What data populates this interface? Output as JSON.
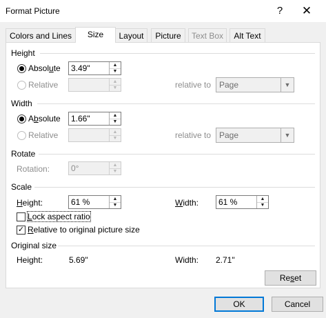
{
  "window": {
    "title": "Format Picture",
    "help_glyph": "?",
    "close_glyph": "✕"
  },
  "tabs": [
    {
      "label": "Colors and Lines",
      "state": "normal"
    },
    {
      "label": "Size",
      "state": "active"
    },
    {
      "label": "Layout",
      "state": "normal"
    },
    {
      "label": "Picture",
      "state": "normal"
    },
    {
      "label": "Text Box",
      "state": "disabled"
    },
    {
      "label": "Alt Text",
      "state": "normal"
    }
  ],
  "height": {
    "section": "Height",
    "absolute": {
      "pre": "Absol",
      "accel": "u",
      "post": "te",
      "value": "3.49\"",
      "selected": true
    },
    "relative": {
      "label": "Relative",
      "value": ""
    },
    "relative_to_label": "relative to",
    "relative_to_value": "Page"
  },
  "width": {
    "section": "Width",
    "absolute": {
      "pre": "A",
      "accel": "b",
      "post": "solute",
      "value": "1.66\"",
      "selected": true
    },
    "relative": {
      "label": "Relative",
      "value": ""
    },
    "relative_to_label": "relative to",
    "relative_to_value": "Page"
  },
  "rotate": {
    "section": "Rotate",
    "label": "Rotation:",
    "value": "0°"
  },
  "scale": {
    "section": "Scale",
    "height_pre": "",
    "height_accel": "H",
    "height_post": "eight:",
    "height_value": "61 %",
    "width_pre": "",
    "width_accel": "W",
    "width_post": "idth:",
    "width_value": "61 %",
    "lock_pre": "",
    "lock_accel": "L",
    "lock_post": "ock aspect ratio",
    "lock_checked": false,
    "relative_pre": "",
    "relative_accel": "R",
    "relative_post": "elative to original picture size",
    "relative_checked": true
  },
  "original": {
    "section": "Original size",
    "height_label": "Height:",
    "height_value": "5.69\"",
    "width_label": "Width:",
    "width_value": "2.71\""
  },
  "buttons": {
    "reset_pre": "Re",
    "reset_accel": "s",
    "reset_post": "et",
    "ok": "OK",
    "cancel": "Cancel"
  },
  "glyphs": {
    "up": "▲",
    "down": "▼",
    "caret": "▼",
    "check": "✓"
  }
}
